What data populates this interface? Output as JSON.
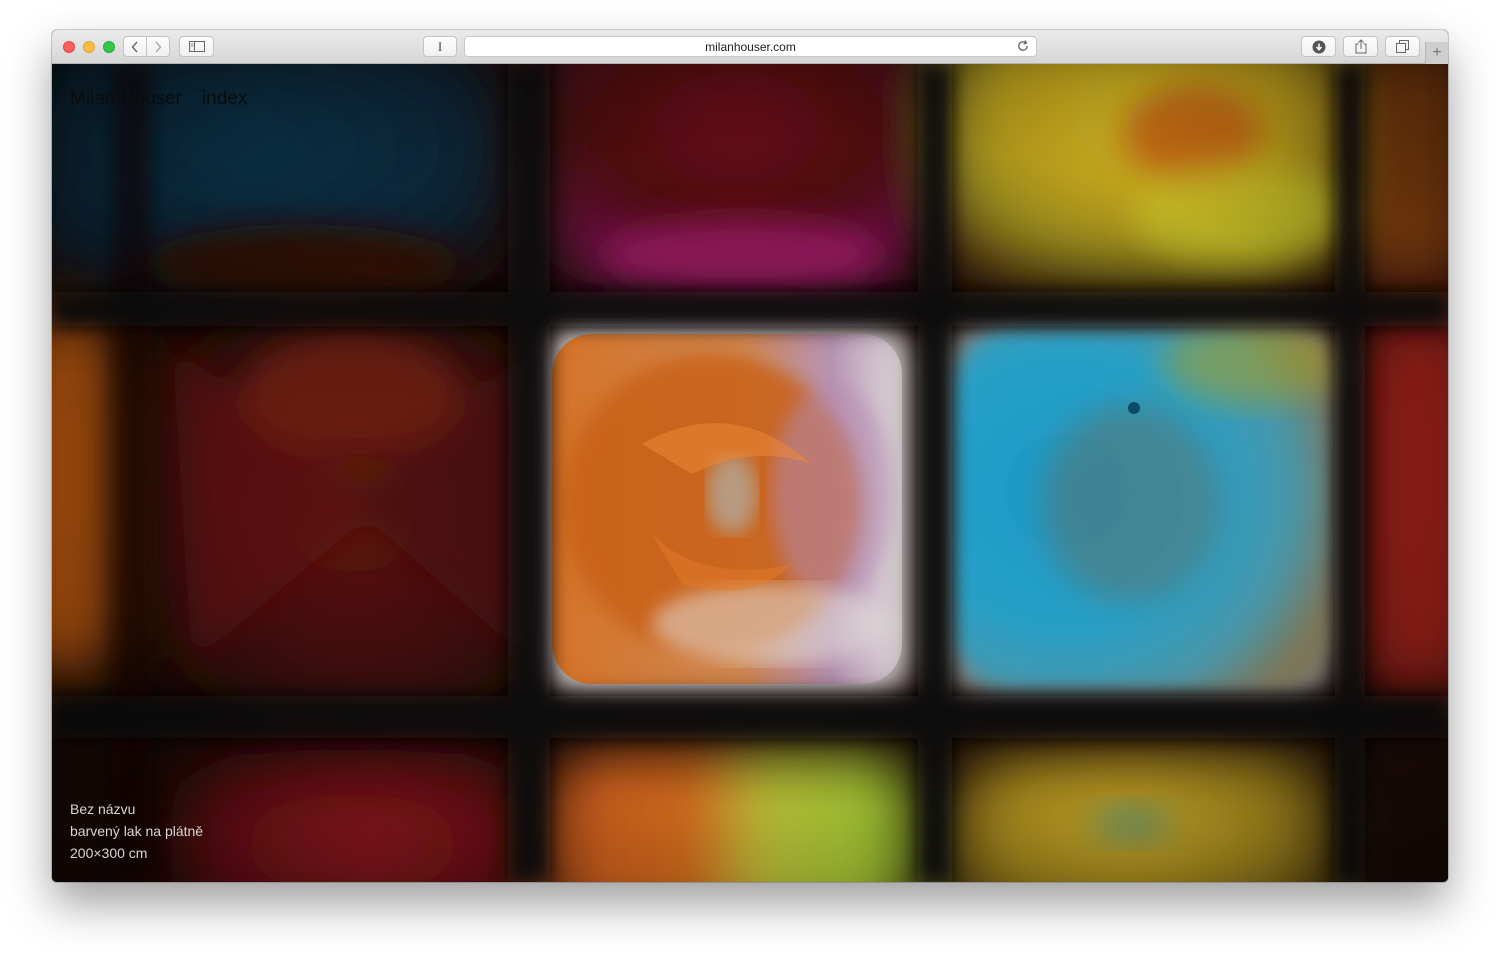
{
  "browser": {
    "url": "milanhouser.com",
    "reader_label": "I",
    "new_tab_label": "+",
    "icons": {
      "back": "chevron-left-icon",
      "forward": "chevron-right-icon",
      "sidebar": "sidebar-icon",
      "reload": "reload-icon",
      "downloads": "download-icon",
      "share": "share-icon",
      "tabs": "tabs-icon"
    }
  },
  "site": {
    "name": "Milan Houser",
    "nav_index": "index"
  },
  "artwork": {
    "title": "Bez názvu",
    "medium": "barvený lak na plátně",
    "dimensions": "200×300 cm"
  },
  "colors": {
    "traffic_red": "#fc605b",
    "traffic_yellow": "#fdbc40",
    "traffic_green": "#34c84a",
    "caption_text": "#d9d5d0",
    "nav_text": "#0b0b0b"
  }
}
